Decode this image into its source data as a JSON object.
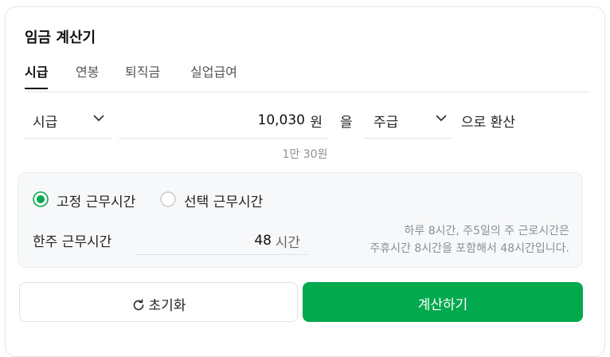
{
  "title": "임금 계산기",
  "tabs": [
    {
      "label": "시급",
      "active": true
    },
    {
      "label": "연봉",
      "active": false
    },
    {
      "label": "퇴직금",
      "active": false
    },
    {
      "label": "실업급여",
      "active": false
    }
  ],
  "converter": {
    "from_unit": "시급",
    "amount": "10,030",
    "currency": "원",
    "particle": "을",
    "to_unit": "주급",
    "suffix": "으로 환산",
    "korean_amount": "1만 30원"
  },
  "work_hours": {
    "options": [
      {
        "label": "고정 근무시간",
        "selected": true
      },
      {
        "label": "선택 근무시간",
        "selected": false
      }
    ],
    "weekly_label": "한주 근무시간",
    "weekly_hours": "48",
    "weekly_unit": "시간",
    "note_line1": "하루 8시간, 주5일의 주 근로시간은",
    "note_line2": "주휴시간 8시간을 포함해서 48시간입니다."
  },
  "buttons": {
    "reset": "초기화",
    "calculate": "계산하기"
  },
  "colors": {
    "accent": "#03a94d",
    "border": "#dfe2e6",
    "panel_bg": "#f7f8f9",
    "hint_text": "#8a8f96"
  }
}
